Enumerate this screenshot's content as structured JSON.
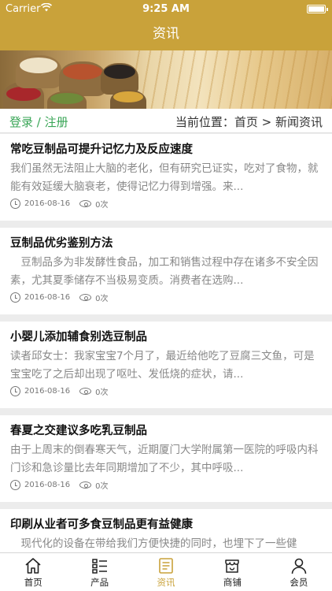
{
  "status_bar": {
    "carrier": "Carrier",
    "time": "9:25 AM"
  },
  "navbar": {
    "title": "资讯"
  },
  "location_bar": {
    "login_text": "登录 / 注册",
    "location_text": "当前位置：首页 > 新闻资讯"
  },
  "articles": [
    {
      "title": "常吃豆制品可提升记忆力及反应速度",
      "summary": "我们虽然无法阻止大脑的老化，但有研究已证实，吃对了食物，就能有效延缓大脑衰老，使得记忆力得到增强。来...",
      "date": "2016-08-16",
      "views": "0次"
    },
    {
      "title": "豆制品优劣鉴别方法",
      "summary": "　豆制品多为非发酵性食品，加工和销售过程中存在诸多不安全因素，尤其夏季储存不当极易变质。消费者在选购...",
      "date": "2016-08-16",
      "views": "0次"
    },
    {
      "title": "小婴儿添加辅食别选豆制品",
      "summary": "读者邱女士：我家宝宝7个月了，最近给他吃了豆腐三文鱼，可是宝宝吃了之后却出现了呕吐、发低烧的症状，请...",
      "date": "2016-08-16",
      "views": "0次"
    },
    {
      "title": "春夏之交建议多吃乳豆制品",
      "summary": "由于上周末的倒春寒天气，近期厦门大学附属第一医院的呼吸内科门诊和急诊量比去年同期增加了不少，其中呼吸...",
      "date": "2016-08-16",
      "views": "0次"
    },
    {
      "title": "印刷从业者可多食豆制品更有益健康",
      "summary": "　现代化的设备在带给我们方便快捷的同时，也埋下了一些健",
      "date": "",
      "views": ""
    }
  ],
  "tab_bar": {
    "items": [
      {
        "label": "首页",
        "icon": "home-icon"
      },
      {
        "label": "产品",
        "icon": "list-icon"
      },
      {
        "label": "资讯",
        "icon": "news-icon",
        "active": true
      },
      {
        "label": "商铺",
        "icon": "shop-icon"
      },
      {
        "label": "会员",
        "icon": "user-icon"
      }
    ],
    "active_color": "#c9a23a"
  },
  "colors": {
    "brand": "#c9a23a",
    "login_green": "#3aa657"
  }
}
